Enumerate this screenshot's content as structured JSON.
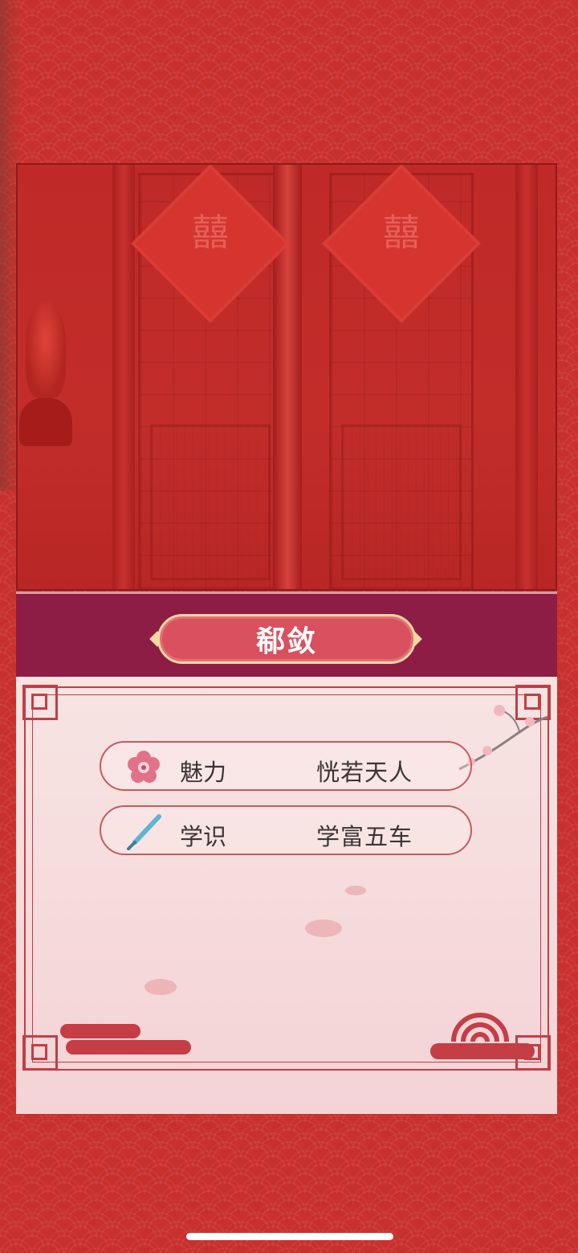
{
  "character": {
    "name": "郗敛"
  },
  "stats": [
    {
      "icon": "plum-blossom-icon",
      "label": "魅力",
      "value": "恍若天人"
    },
    {
      "icon": "brush-icon",
      "label": "学识",
      "value": "学富五车"
    }
  ],
  "scene": {
    "couplet_char": "囍"
  },
  "colors": {
    "background": "#c8302e",
    "name_band": "#8d1d44",
    "plaque": "#d9505e",
    "frame": "#c53d45",
    "card": "#f6dcdd"
  }
}
